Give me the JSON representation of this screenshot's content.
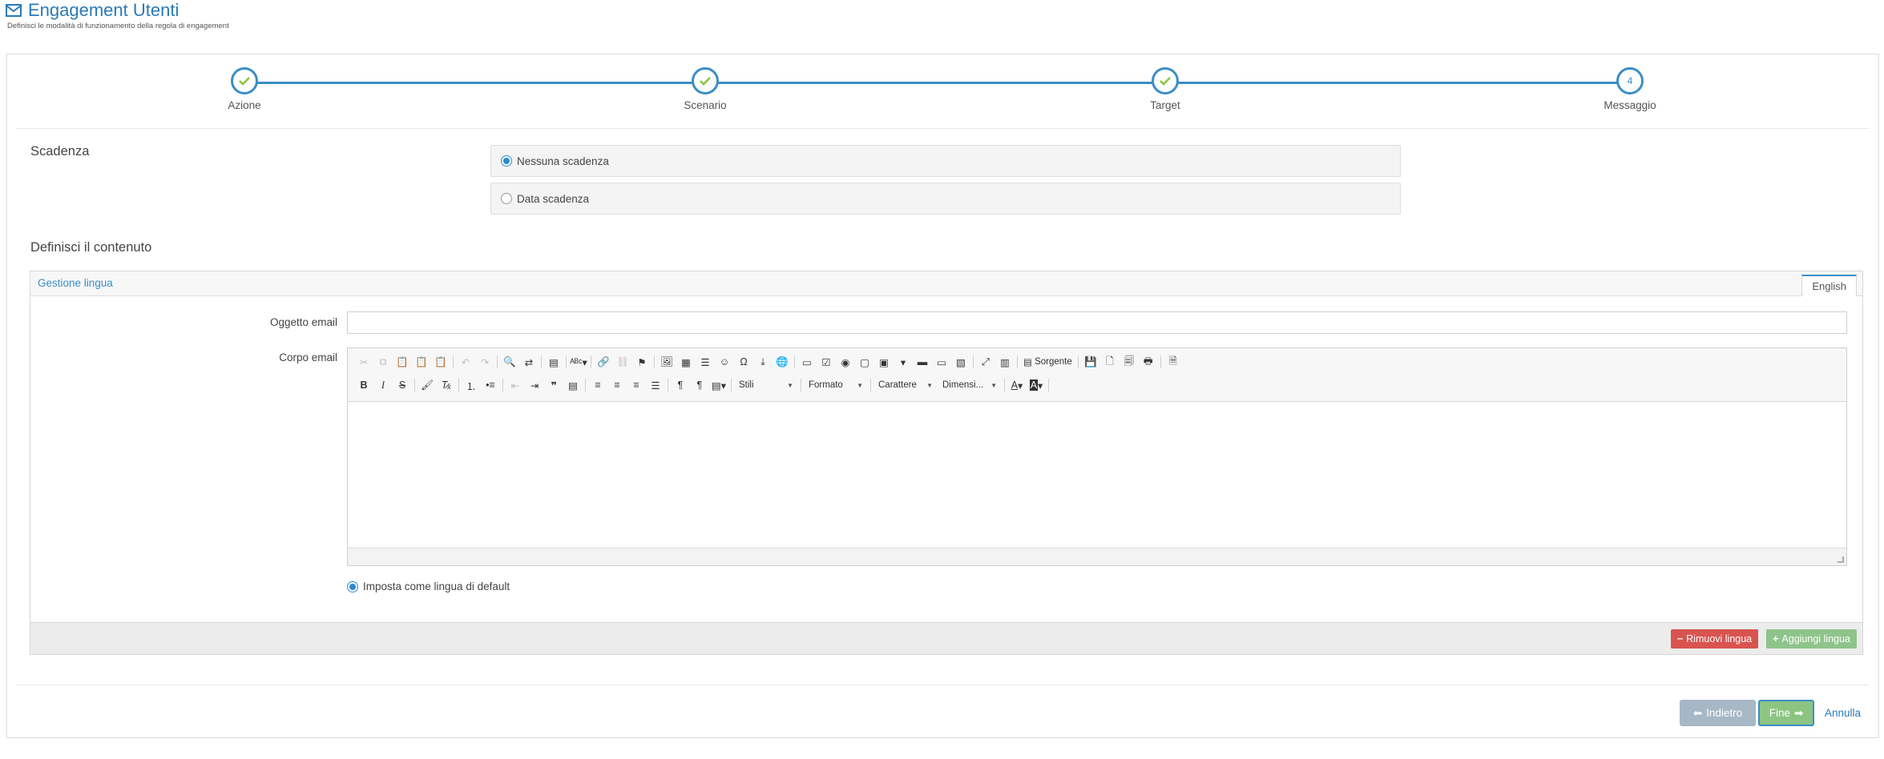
{
  "header": {
    "title": "Engagement Utenti",
    "subtitle": "Definisci le modalità di funzionamento della regola di engagement"
  },
  "stepper": {
    "steps": [
      {
        "label": "Azione",
        "state": "done"
      },
      {
        "label": "Scenario",
        "state": "done"
      },
      {
        "label": "Target",
        "state": "done"
      },
      {
        "label": "Messaggio",
        "state": "current",
        "number": "4"
      }
    ],
    "done_color": "#8cc63f",
    "line_color": "#3b8ec6"
  },
  "expiry": {
    "title": "Scadenza",
    "options": [
      {
        "label": "Nessuna scadenza",
        "selected": true
      },
      {
        "label": "Data scadenza",
        "selected": false
      }
    ]
  },
  "content": {
    "title": "Definisci il contenuto",
    "language_management": "Gestione lingua",
    "active_tab": "English",
    "subject_label": "Oggetto email",
    "subject_value": "",
    "body_label": "Corpo email",
    "editor": {
      "source_label": "Sorgente",
      "combos": [
        "Stili",
        "Formato",
        "Carattere",
        "Dimensi..."
      ]
    },
    "default_language_label": "Imposta come lingua di default",
    "remove_language_label": "Rimuovi lingua",
    "add_language_label": "Aggiungi lingua"
  },
  "footer": {
    "back_label": "Indietro",
    "done_label": "Fine",
    "cancel_label": "Annulla"
  }
}
